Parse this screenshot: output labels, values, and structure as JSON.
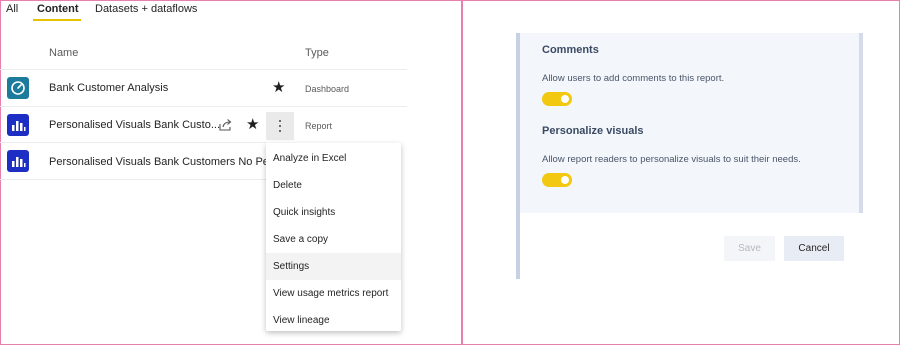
{
  "tabs": {
    "all": "All",
    "content": "Content",
    "datasets": "Datasets + dataflows"
  },
  "columns": {
    "name": "Name",
    "type": "Type"
  },
  "rows": [
    {
      "name": "Bank Customer Analysis",
      "type": "Dashboard",
      "icon": "dashboard-gauge-icon"
    },
    {
      "name": "Personalised Visuals Bank Custo...",
      "type": "Report",
      "icon": "report-bar-chart-icon"
    },
    {
      "name": "Personalised Visuals Bank Customers No Perspe",
      "type": "",
      "icon": "report-bar-chart-icon"
    }
  ],
  "menu": {
    "items": [
      "Analyze in Excel",
      "Delete",
      "Quick insights",
      "Save a copy",
      "Settings",
      "View usage metrics report",
      "View lineage"
    ],
    "hovered": "Settings"
  },
  "settings": {
    "comments_heading": "Comments",
    "comments_desc": "Allow users to add comments to this report.",
    "comments_enabled": true,
    "personalize_heading": "Personalize visuals",
    "personalize_desc": "Allow report readers to personalize visuals to suit their needs.",
    "personalize_enabled": true,
    "save_label": "Save",
    "cancel_label": "Cancel"
  },
  "colors": {
    "accent_yellow": "#f2c811",
    "dashboard_icon": "#1c7a9c",
    "report_icon": "#1d2ec4",
    "frame_border": "#e87fae"
  }
}
